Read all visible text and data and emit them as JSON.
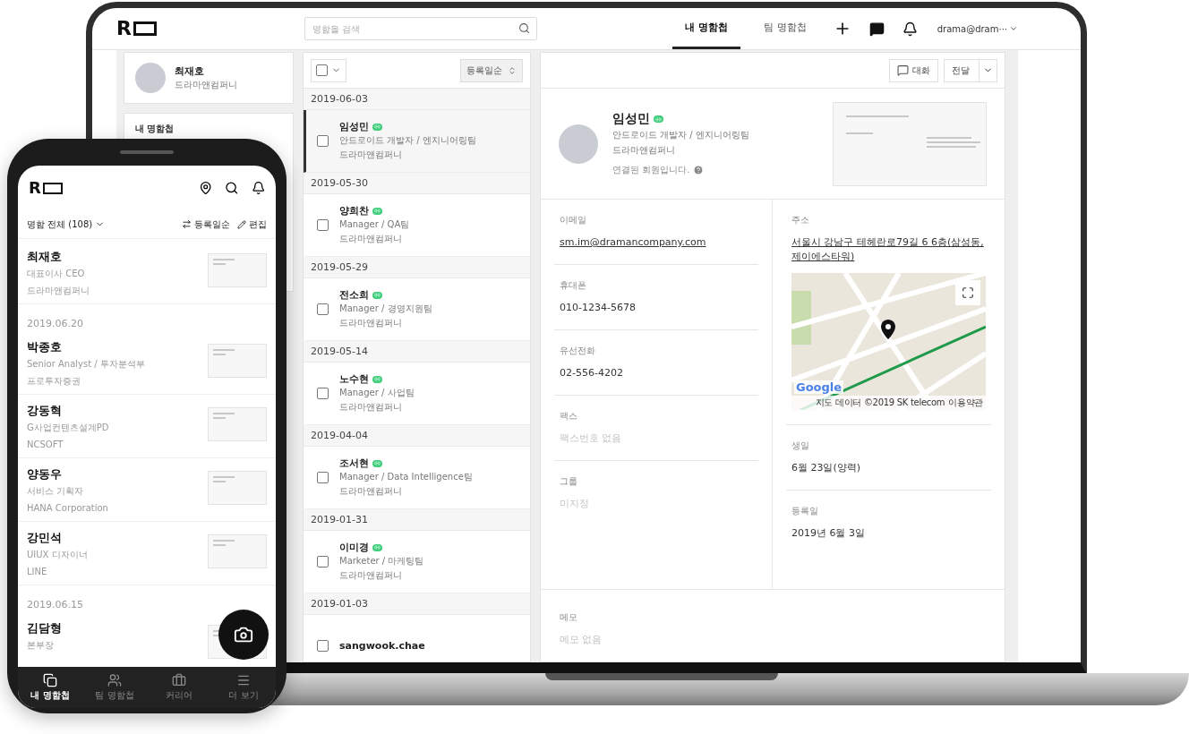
{
  "laptop": {
    "topbar": {
      "logo": "R",
      "search": {
        "placeholder": "명함을 검색"
      },
      "tabs": [
        {
          "label": "내 명함첩",
          "selected": true
        },
        {
          "label": "팀 명함첩",
          "selected": false
        }
      ],
      "account": "drama@dram···"
    },
    "profile": {
      "name": "최재호",
      "company": "드라마앤컴퍼니"
    },
    "side_card": {
      "title": "내 명함첩"
    },
    "list": {
      "select_all": {
        "checked": false
      },
      "sort": "등록일순",
      "groups": [
        {
          "date": "2019-06-03",
          "items": [
            {
              "name": "임성민",
              "linked": true,
              "title": "안드로이드 개발자 / 엔지니어링팀",
              "company": "드라마앤컴퍼니",
              "checked": false,
              "selected": true
            }
          ]
        },
        {
          "date": "2019-05-30",
          "items": [
            {
              "name": "양희찬",
              "linked": true,
              "title": "Manager / QA팀",
              "company": "드라마앤컴퍼니",
              "checked": false,
              "selected": false
            }
          ]
        },
        {
          "date": "2019-05-29",
          "items": [
            {
              "name": "전소희",
              "linked": true,
              "title": "Manager / 경영지원팀",
              "company": "드라마앤컴퍼니",
              "checked": false,
              "selected": false
            }
          ]
        },
        {
          "date": "2019-05-14",
          "items": [
            {
              "name": "노수현",
              "linked": true,
              "title": "Manager / 사업팀",
              "company": "드라마앤컴퍼니",
              "checked": false,
              "selected": false
            }
          ]
        },
        {
          "date": "2019-04-04",
          "items": [
            {
              "name": "조서현",
              "linked": true,
              "title": "Manager / Data Intelligence팀",
              "company": "드라마앤컴퍼니",
              "checked": false,
              "selected": false
            }
          ]
        },
        {
          "date": "2019-01-31",
          "items": [
            {
              "name": "이미경",
              "linked": true,
              "title": "Marketer / 마케팅팀",
              "company": "드라마앤컴퍼니",
              "checked": false,
              "selected": false
            }
          ]
        },
        {
          "date": "2019-01-03",
          "items": [
            {
              "name": "sangwook.chae",
              "linked": false,
              "checked": false,
              "selected": false
            }
          ]
        }
      ]
    },
    "detail": {
      "actions": [
        {
          "label": "대화",
          "kind": "chat"
        },
        {
          "label": "전달",
          "kind": "split"
        }
      ],
      "name": "임성민",
      "linked": true,
      "title": "안드로이드 개발자 / 엔지니어링팀",
      "company": "드라마앤컴퍼니",
      "status": "연결된 회원입니다.",
      "fields_left": [
        {
          "label": "이메일",
          "value": "sm.im@dramancompany.com",
          "kind": "link"
        },
        {
          "label": "휴대폰",
          "value": "010-1234-5678",
          "kind": "text"
        },
        {
          "label": "유선전화",
          "value": "02-556-4202",
          "kind": "text"
        },
        {
          "label": "팩스",
          "value": "팩스번호 없음",
          "kind": "empty"
        },
        {
          "label": "그룹",
          "value": "미지정",
          "kind": "empty"
        }
      ],
      "fields_right": [
        {
          "label": "주소",
          "value": "서울시 강남구 테헤란로79길 6 6층(삼성동, 제이에스타워)",
          "kind": "address"
        },
        {
          "label": "생일",
          "value": "6월 23일(양력)",
          "kind": "text"
        },
        {
          "label": "등록일",
          "value": "2019년 6월 3일",
          "kind": "text"
        }
      ],
      "map": {
        "logo": "Google",
        "attribution": "지도 데이터 ©2019 SK telecom",
        "terms": "이용약관"
      },
      "memo": {
        "label": "메모",
        "value": "메모 없음"
      }
    }
  },
  "phone": {
    "logo": "R",
    "filter": "명함 전체 (108)",
    "sort": "등록일순",
    "edit": "편집",
    "entries": [
      {
        "kind": "contact",
        "name": "최재호",
        "title": "대표이사 CEO",
        "company": "드라마앤컴퍼니"
      },
      {
        "kind": "date",
        "text": "2019.06.20"
      },
      {
        "kind": "contact",
        "name": "박종호",
        "title": "Senior Analyst / 투자분석부",
        "company": "프로투자증권"
      },
      {
        "kind": "contact",
        "name": "강동혁",
        "title": "G사업컨텐츠설계PD",
        "company": "NCSOFT"
      },
      {
        "kind": "contact",
        "name": "양동우",
        "title": "서비스 기획자",
        "company": "HANA Corporation"
      },
      {
        "kind": "contact",
        "name": "강민석",
        "title": "UIUX 디자이너",
        "company": "LINE"
      },
      {
        "kind": "date",
        "text": "2019.06.15"
      },
      {
        "kind": "contact",
        "name": "김담형",
        "title": "본부장"
      }
    ],
    "nav": [
      {
        "label": "내 명함첩",
        "kind": "cards",
        "selected": true
      },
      {
        "label": "팀 명함첩",
        "kind": "team",
        "selected": false
      },
      {
        "label": "커리어",
        "kind": "career",
        "selected": false
      },
      {
        "label": "더 보기",
        "kind": "more",
        "selected": false
      }
    ]
  }
}
